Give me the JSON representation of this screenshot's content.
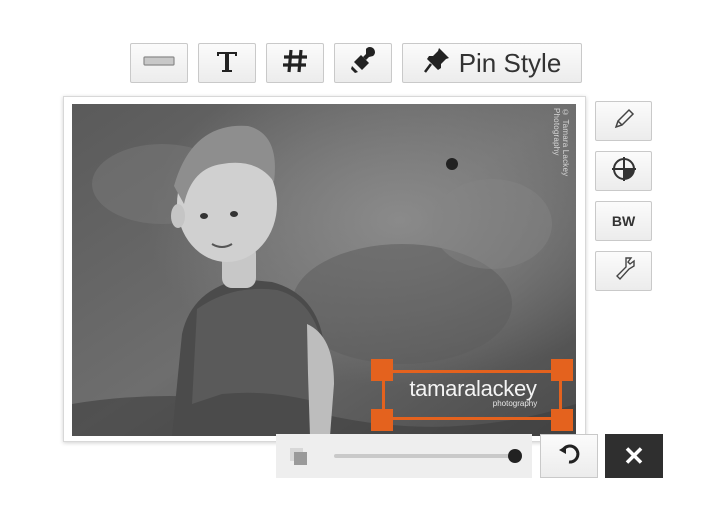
{
  "toolbar": {
    "items": [
      {
        "name": "separator-style",
        "icon": "horizontal-rule-icon"
      },
      {
        "name": "text-style",
        "icon": "text-t-icon"
      },
      {
        "name": "hashtag-style",
        "icon": "hash-icon"
      },
      {
        "name": "stamp-style",
        "icon": "stamp-icon"
      }
    ],
    "pin_style_label": "Pin Style",
    "pin_style_icon": "pushpin-icon"
  },
  "side_tools": {
    "edit_icon": "pencil-icon",
    "crop_icon": "crop-circle-icon",
    "bw_label": "BW",
    "tools_icon": "wrench-icon"
  },
  "photo": {
    "credit_text": "© Tamara Lackey Photography",
    "watermark": {
      "main": "tamaralackey",
      "sub": "photography"
    },
    "overlay_color": "#e4621e"
  },
  "controls": {
    "opacity_icon": "layers-icon",
    "opacity_value": 1.0,
    "undo_icon": "rotate-icon",
    "close_label": "✕"
  }
}
